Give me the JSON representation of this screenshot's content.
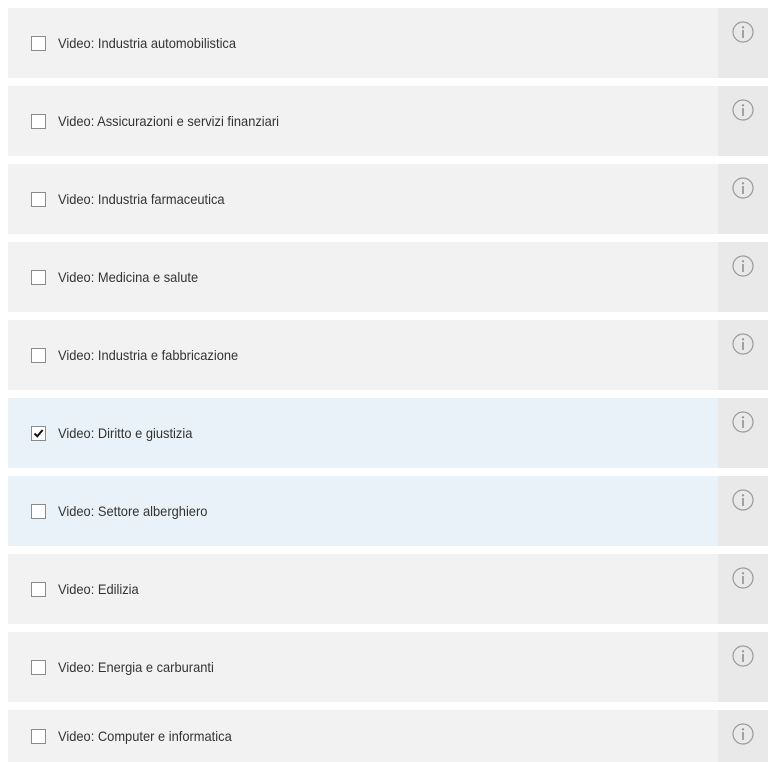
{
  "items": [
    {
      "label": "Video: Industria automobilistica",
      "checked": false,
      "highlighted": false
    },
    {
      "label": "Video: Assicurazioni e servizi finanziari",
      "checked": false,
      "highlighted": false
    },
    {
      "label": "Video: Industria farmaceutica",
      "checked": false,
      "highlighted": false
    },
    {
      "label": "Video: Medicina e salute",
      "checked": false,
      "highlighted": false
    },
    {
      "label": "Video: Industria e fabbricazione",
      "checked": false,
      "highlighted": false
    },
    {
      "label": "Video: Diritto e giustizia",
      "checked": true,
      "highlighted": true
    },
    {
      "label": "Video: Settore alberghiero",
      "checked": false,
      "highlighted": true
    },
    {
      "label": "Video: Edilizia",
      "checked": false,
      "highlighted": false
    },
    {
      "label": "Video: Energia e carburanti",
      "checked": false,
      "highlighted": false
    },
    {
      "label": "Video: Computer e informatica",
      "checked": false,
      "highlighted": false
    }
  ],
  "icons": {
    "checkbox_check": "check-icon",
    "info": "info-icon"
  },
  "colors": {
    "row_bg": "#f2f2f2",
    "row_highlight_bg": "#e8f2f8",
    "info_panel_bg": "#e9e9e9"
  }
}
